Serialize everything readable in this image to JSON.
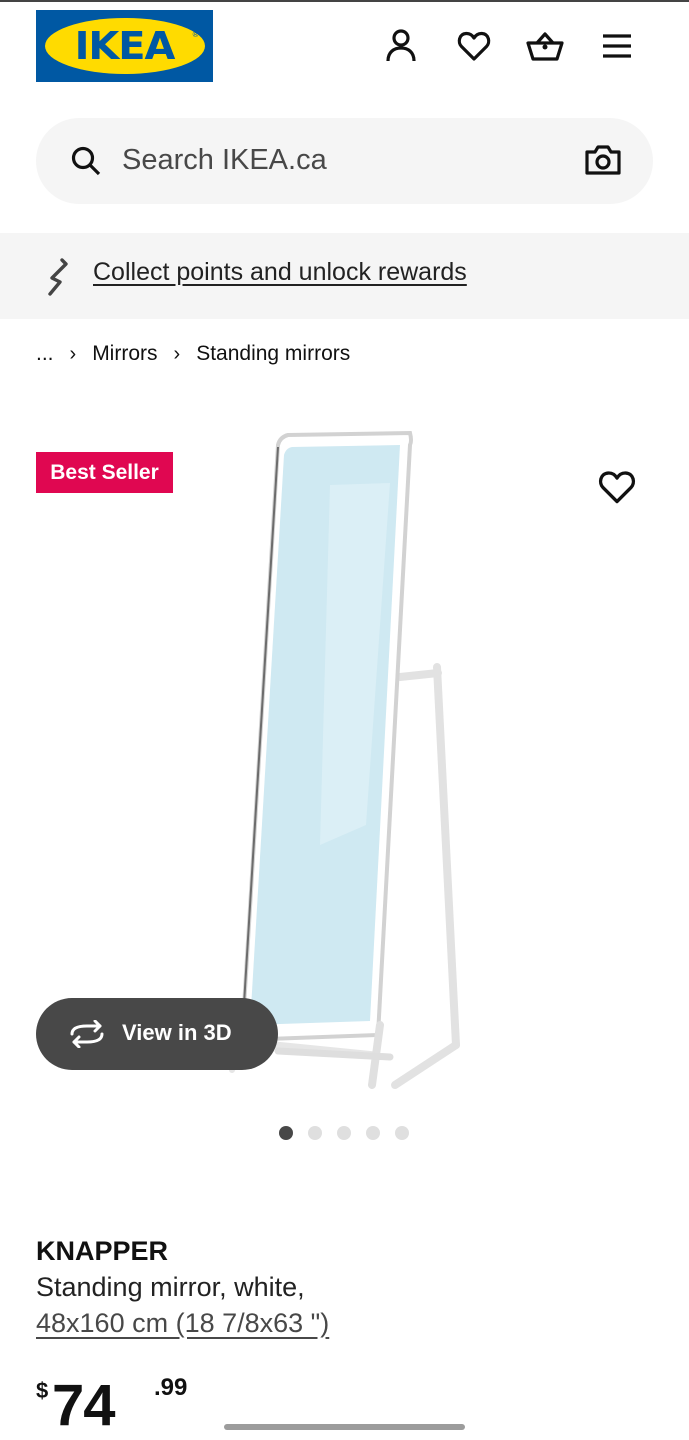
{
  "header": {
    "logo_text": "IKEA",
    "icons": [
      "account-icon",
      "heart-icon",
      "basket-icon",
      "menu-icon"
    ]
  },
  "search": {
    "placeholder": "Search IKEA.ca",
    "icons": [
      "search-icon",
      "camera-icon"
    ]
  },
  "promo": {
    "text": "Collect points and unlock rewards",
    "icon": "rewards-link-icon"
  },
  "breadcrumb": {
    "ellipsis": "...",
    "items": [
      "Mirrors",
      "Standing mirrors"
    ]
  },
  "product": {
    "badge": "Best Seller",
    "view_3d_label": "View in 3D",
    "image_count": 5,
    "active_image": 1,
    "name": "KNAPPER",
    "description": "Standing mirror, white,",
    "dimensions": "48x160 cm (18 7/8x63 \")",
    "price": {
      "currency": "$",
      "whole": "74",
      "decimal": ".99"
    }
  },
  "colors": {
    "brand_blue": "#0058a3",
    "brand_yellow": "#ffdb00",
    "badge_red": "#e00751",
    "dark_gray": "#484848"
  }
}
